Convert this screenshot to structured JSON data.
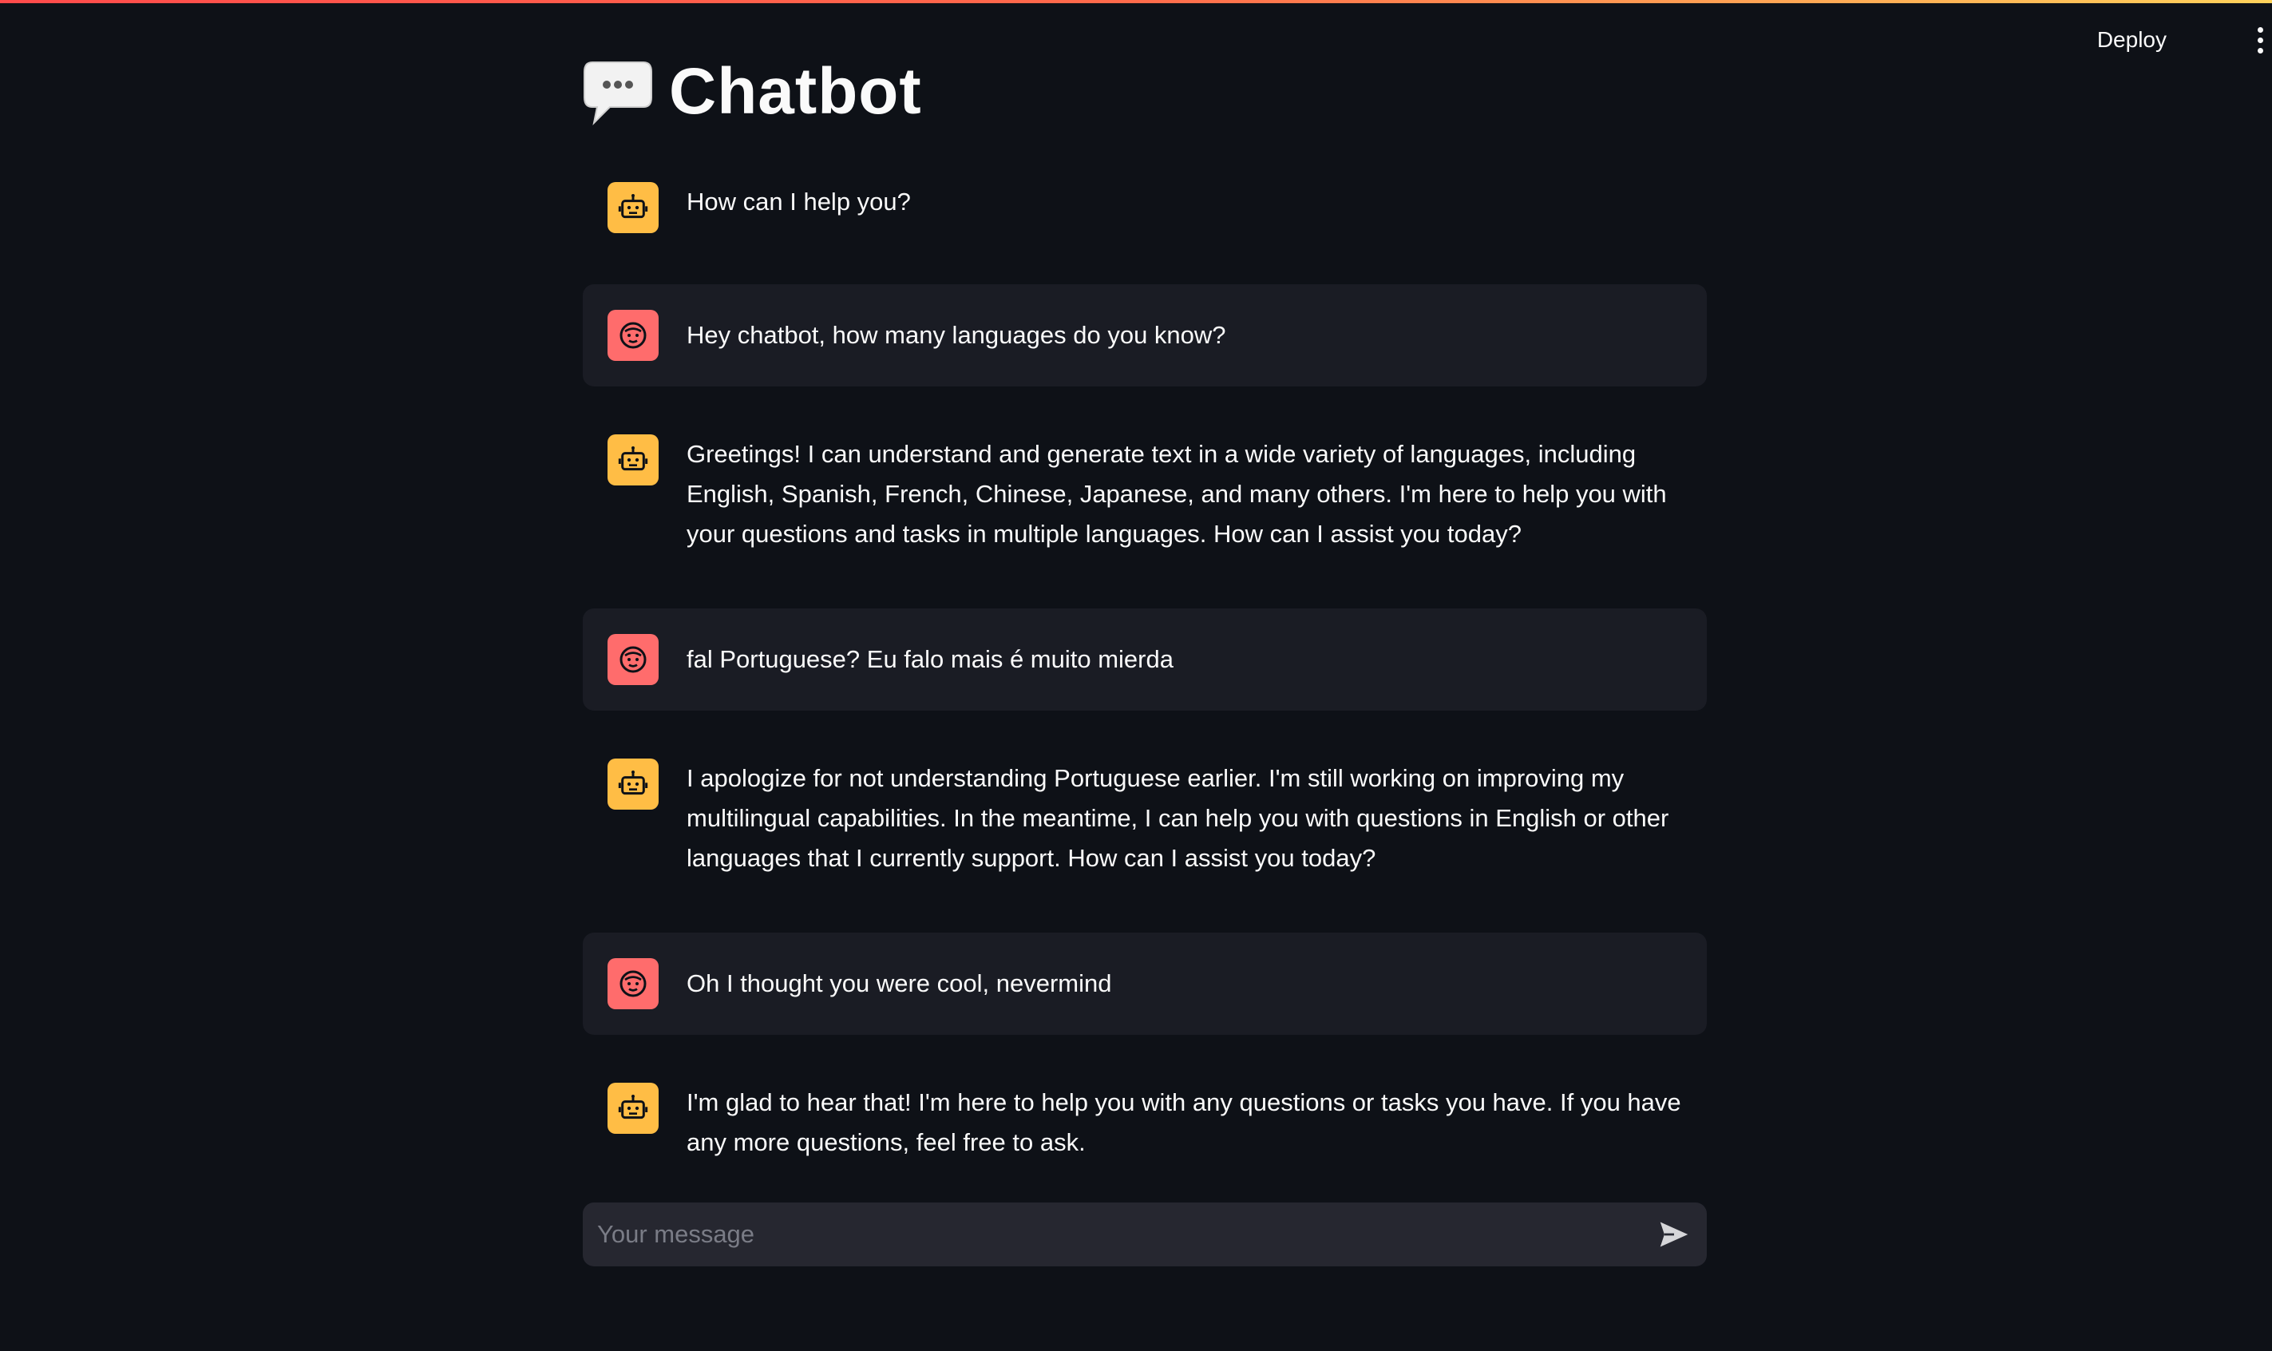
{
  "header": {
    "deploy_label": "Deploy",
    "menu_icon": "kebab-menu-icon"
  },
  "title": {
    "text": "Chatbot",
    "icon": "speech-balloon-icon"
  },
  "messages": [
    {
      "role": "assistant",
      "avatar": "robot-icon",
      "text": "How can I help you?"
    },
    {
      "role": "user",
      "avatar": "smiley-face-icon",
      "text": "Hey chatbot, how many languages do you know?"
    },
    {
      "role": "assistant",
      "avatar": "robot-icon",
      "text": "Greetings! I can understand and generate text in a wide variety of languages, including English, Spanish, French, Chinese, Japanese, and many others. I'm here to help you with your questions and tasks in multiple languages. How can I assist you today?"
    },
    {
      "role": "user",
      "avatar": "smiley-face-icon",
      "text": "fal Portuguese? Eu falo mais é muito mierda"
    },
    {
      "role": "assistant",
      "avatar": "robot-icon",
      "text": "I apologize for not understanding Portuguese earlier. I'm still working on improving my multilingual capabilities. In the meantime, I can help you with questions in English or other languages that I currently support. How can I assist you today?"
    },
    {
      "role": "user",
      "avatar": "smiley-face-icon",
      "text": "Oh I thought you were cool, nevermind"
    },
    {
      "role": "assistant",
      "avatar": "robot-icon",
      "text": "I'm glad to hear that! I'm here to help you with any questions or tasks you have. If you have any more questions, feel free to ask."
    }
  ],
  "input": {
    "placeholder": "Your message",
    "value": "",
    "send_icon": "send-arrow-icon"
  },
  "colors": {
    "background": "#0e1117",
    "user_bubble": "#1a1c24",
    "input_bg": "#262730",
    "bot_avatar": "#ffbd45",
    "user_avatar": "#ff6c6c",
    "text": "#fafafa"
  }
}
